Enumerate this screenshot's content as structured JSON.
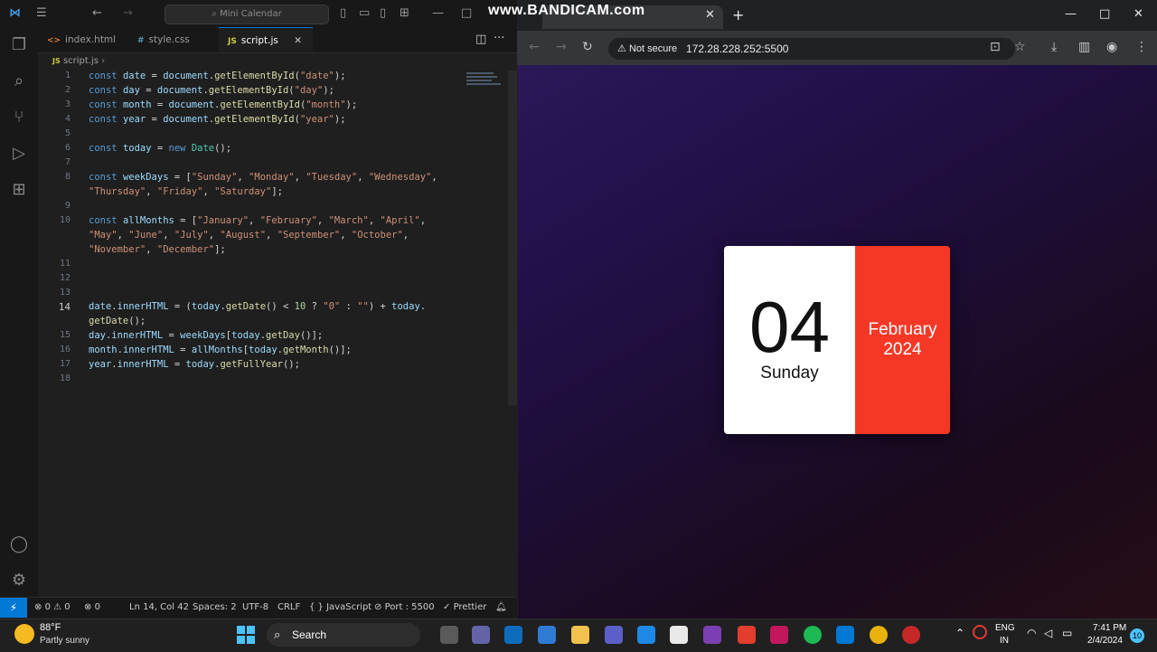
{
  "vscode": {
    "search_text": "Mini Calendar",
    "tabs": [
      {
        "label": "index.html",
        "icon": "<>"
      },
      {
        "label": "style.css",
        "icon": "#"
      },
      {
        "label": "script.js",
        "icon": "JS"
      }
    ],
    "breadcrumb": "script.js",
    "line_numbers": [
      "1",
      "2",
      "3",
      "4",
      "5",
      "6",
      "7",
      "8",
      "9",
      "10",
      "11",
      "12",
      "13",
      "14",
      "15",
      "16",
      "17",
      "18"
    ],
    "status": {
      "errors": "0",
      "warnings": "0",
      "ports_count": "0",
      "position": "Ln 14, Col 42",
      "spaces": "Spaces: 2",
      "encoding": "UTF-8",
      "eol": "CRLF",
      "language": "JavaScript",
      "port": "Port : 5500",
      "prettier": "Prettier"
    }
  },
  "browser": {
    "watermark": "www.BANDICAM.com",
    "security": "Not secure",
    "url": "172.28.228.252:5500",
    "calendar": {
      "date": "04",
      "day": "Sunday",
      "month": "February",
      "year": "2024"
    }
  },
  "taskbar": {
    "weather_temp": "88°F",
    "weather_desc": "Partly sunny",
    "search_label": "Search",
    "lang_1": "ENG",
    "lang_2": "IN",
    "time": "7:41 PM",
    "date": "2/4/2024",
    "notification_count": "10"
  },
  "colors": {
    "accent_red": "#f53826",
    "vscode_blue": "#0078d4"
  }
}
